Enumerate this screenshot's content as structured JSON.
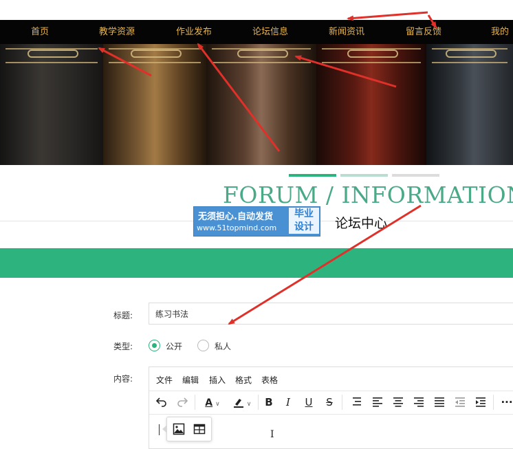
{
  "nav": {
    "items": [
      {
        "label": "首页"
      },
      {
        "label": "教学资源"
      },
      {
        "label": "作业发布"
      },
      {
        "label": "论坛信息"
      },
      {
        "label": "新闻资讯"
      },
      {
        "label": "留言反馈"
      },
      {
        "label": "我的"
      }
    ]
  },
  "section": {
    "title_en": "FORUM / INFORMATION",
    "title_cn": "论坛中心"
  },
  "watermark": {
    "line1": "无须担心.自动发货",
    "line2": "www.51topmind.com",
    "badge_line1": "毕业",
    "badge_line2": "设计"
  },
  "form": {
    "title_label": "标题:",
    "title_value": "练习书法",
    "type_label": "类型:",
    "type_options": [
      {
        "label": "公开",
        "selected": true
      },
      {
        "label": "私人",
        "selected": false
      }
    ],
    "content_label": "内容:"
  },
  "editor": {
    "menubar": [
      "文件",
      "编辑",
      "插入",
      "格式",
      "表格"
    ],
    "toolbar_icons": [
      "undo-icon",
      "redo-icon",
      "text-color-icon",
      "highlight-icon",
      "bold-icon",
      "italic-icon",
      "underline-icon",
      "strikethrough-icon",
      "list-icon",
      "align-left-icon",
      "align-center-icon",
      "align-right-icon",
      "align-justify-icon",
      "outdent-icon",
      "indent-icon",
      "more-icon"
    ],
    "bold_glyph": "B",
    "italic_glyph": "I",
    "underline_glyph": "U",
    "strike_glyph": "S",
    "text_color_glyph": "A",
    "more_glyph": "···",
    "popup_icons": [
      "image-icon",
      "table-icon"
    ]
  },
  "colors": {
    "accent": "#2db47e",
    "nav_text": "#e8b54a",
    "nav_bg": "#050505",
    "heading_en": "#4aa987",
    "watermark": "#4a91d4",
    "annotation_arrow": "#e0302a"
  }
}
